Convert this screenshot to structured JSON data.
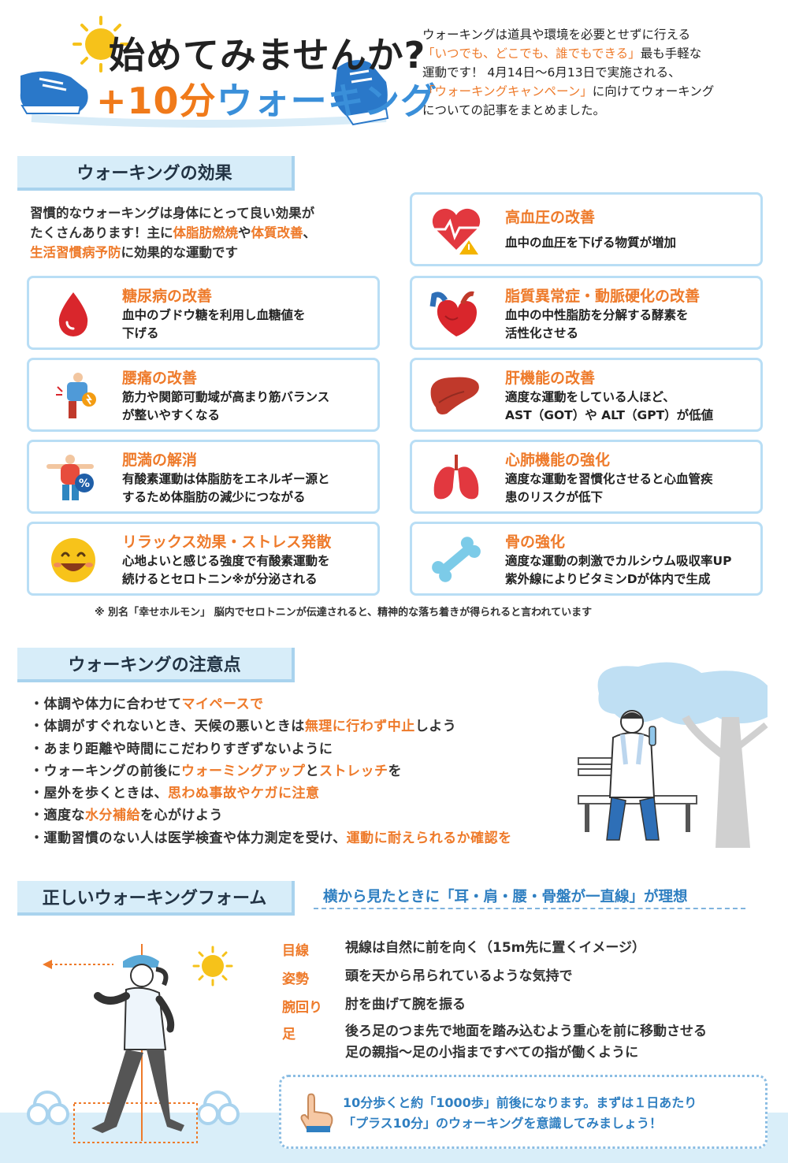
{
  "header": {
    "title_line1": "始めてみませんか?",
    "title_plus": "+10分",
    "title_kana": "ウォーキング",
    "intro_a": "ウォーキングは道具や環境を必要とせずに行える",
    "intro_b": "「いつでも、どこでも、誰でもできる」",
    "intro_c": "最も手軽な",
    "intro_d": "運動です！ 4月14日〜6月13日で実施される、",
    "intro_e": "「ウォーキングキャンペーン」",
    "intro_f": "に向けてウォーキング",
    "intro_g": "についての記事をまとめました。"
  },
  "effects": {
    "tab": "ウォーキングの効果",
    "intro_1": "習慣的なウォーキングは身体にとって良い効果が",
    "intro_2": "たくさんあります！主に",
    "intro_3": "体脂肪燃焼",
    "intro_4": "や",
    "intro_5": "体質改善",
    "intro_6": "、",
    "intro_7": "生活習慣病予防",
    "intro_8": "に効果的な運動です",
    "cards": [
      {
        "title": "糖尿病の改善",
        "line1": "血中のブドウ糖を利用し血糖値を",
        "line2": "下げる",
        "icon": "blood-drop-icon"
      },
      {
        "title": "腰痛の改善",
        "line1": "筋力や関節可動域が高まり筋バランス",
        "line2": "が整いやすくなる",
        "icon": "back-pain-icon"
      },
      {
        "title": "肥満の解消",
        "line1": "有酸素運動は体脂肪をエネルギー源と",
        "line2": "するため体脂肪の減少につながる",
        "icon": "body-fat-icon"
      },
      {
        "title": "リラックス効果・ストレス発散",
        "line1": "心地よいと感じる強度で有酸素運動を",
        "line2": "続けるとセロトニン※が分泌される",
        "icon": "smile-face-icon"
      },
      {
        "title": "高血圧の改善",
        "line1": "血中の血圧を下げる物質が増加",
        "line2": "",
        "icon": "heart-warning-icon"
      },
      {
        "title": "脂質異常症・動脈硬化の改善",
        "line1": "血中の中性脂肪を分解する酵素を",
        "line2": "活性化させる",
        "icon": "heart-organ-icon"
      },
      {
        "title": "肝機能の改善",
        "line1": "適度な運動をしている人ほど、",
        "line2": "AST（GOT）や ALT（GPT）が低値",
        "icon": "liver-icon"
      },
      {
        "title": "心肺機能の強化",
        "line1": "適度な運動を習慣化させると心血管疾",
        "line2": "患のリスクが低下",
        "icon": "lungs-icon"
      },
      {
        "title": "骨の強化",
        "line1": "適度な運動の刺激でカルシウム吸収率UP",
        "line2": "紫外線によりビタミンDが体内で生成",
        "icon": "bone-icon"
      }
    ],
    "footnote": "※ 別名「幸せホルモン」 脳内でセロトニンが伝達されると、精神的な落ち着きが得られると言われています"
  },
  "caution": {
    "tab": "ウォーキングの注意点",
    "items": [
      {
        "a": "・体調や体力に合わせて",
        "b": "マイペースで",
        "c": ""
      },
      {
        "a": "・体調がすぐれないとき、天候の悪いときは",
        "b": "無理に行わず中止",
        "c": "しよう"
      },
      {
        "a": "・あまり距離や時間にこだわりすぎずないように",
        "b": "",
        "c": ""
      },
      {
        "a": "・ウォーキングの前後に",
        "b": "ウォーミングアップ",
        "c": "と",
        "d": "ストレッチ",
        "e": "を"
      },
      {
        "a": "・屋外を歩くときは、",
        "b": "思わぬ事故やケガに注意",
        "c": ""
      },
      {
        "a": "・適度な",
        "b": "水分補給",
        "c": "を心がけよう"
      },
      {
        "a": "・運動習慣のない人は医学検査や体力測定を受け、",
        "b": "運動に耐えられるか確認を",
        "c": ""
      }
    ]
  },
  "form": {
    "tab": "正しいウォーキングフォーム",
    "headline": "横から見たときに「耳・肩・腰・骨盤が一直線」が理想",
    "rows": [
      {
        "label": "目線",
        "value": "視線は自然に前を向く（15m先に置くイメージ）"
      },
      {
        "label": "姿勢",
        "value": "頭を天から吊られているような気持で"
      },
      {
        "label": "腕回り",
        "value": "肘を曲げて腕を振る"
      },
      {
        "label": "足",
        "value": "後ろ足のつま先で地面を踏み込むよう重心を前に移動させる"
      }
    ],
    "foot_line2": "足の親指〜足の小指まですべての指が働くように",
    "tip_1": "10分歩くと約「1000歩」前後になります。まずは１日あたり",
    "tip_2": "「プラス10分」のウォーキングを意識してみましょう！"
  },
  "colors": {
    "accent_orange": "#ee7a2a",
    "accent_blue": "#2f7fc1",
    "card_border": "#b9def5",
    "tab_bg": "#d7edf9"
  }
}
